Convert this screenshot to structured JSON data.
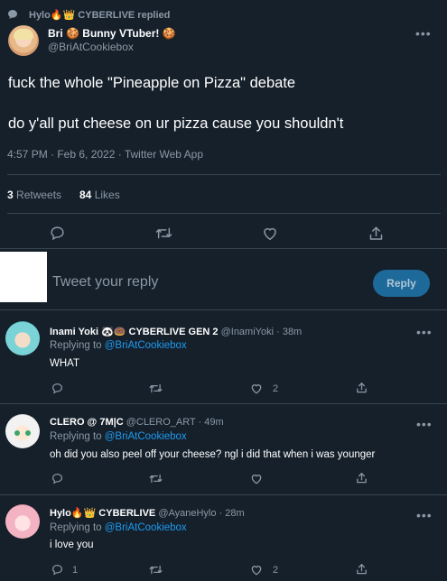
{
  "context": {
    "replied_text": "Hylo🔥👑 CYBERLIVE replied"
  },
  "main_tweet": {
    "display_name": "Bri 🍪 Bunny VTuber! 🍪",
    "handle": "@BriAtCookiebox",
    "line1": "fuck the whole \"Pineapple on Pizza\" debate",
    "line2": "do y'all put cheese on ur pizza cause you shouldn't",
    "timestamp": "4:57 PM · Feb 6, 2022 · Twitter Web App",
    "retweets_count": "3",
    "retweets_label": "Retweets",
    "likes_count": "84",
    "likes_label": "Likes"
  },
  "composer": {
    "placeholder": "Tweet your reply",
    "reply_button": "Reply"
  },
  "replies": [
    {
      "name": "Inami Yoki 🐼🍩 CYBERLIVE GEN 2",
      "handle_time": "@InamiYoki · 38m",
      "replying_label": "Replying to",
      "replying_to": "@BriAtCookiebox",
      "text": "WHAT",
      "reply_count": "",
      "retweet_count": "",
      "like_count": "2"
    },
    {
      "name": "CLERO @ 7M|C",
      "handle_time": "@CLERO_ART · 49m",
      "replying_label": "Replying to",
      "replying_to": "@BriAtCookiebox",
      "text": "oh  did you also peel off your cheese? ngl i did that when i was younger",
      "reply_count": "",
      "retweet_count": "",
      "like_count": ""
    },
    {
      "name": "Hylo🔥👑 CYBERLIVE",
      "handle_time": "@AyaneHylo · 28m",
      "replying_label": "Replying to",
      "replying_to": "@BriAtCookiebox",
      "text": "i love you",
      "reply_count": "1",
      "retweet_count": "",
      "like_count": "2"
    }
  ],
  "icons": {
    "reply": "reply-icon",
    "retweet": "retweet-icon",
    "like": "heart-icon",
    "share": "share-icon",
    "more": "more-icon"
  },
  "colors": {
    "background": "#15202b",
    "accent": "#1d9bf0",
    "reply_button_bg": "#1d6a9a",
    "divider": "#38444d",
    "muted": "#8b98a5"
  }
}
